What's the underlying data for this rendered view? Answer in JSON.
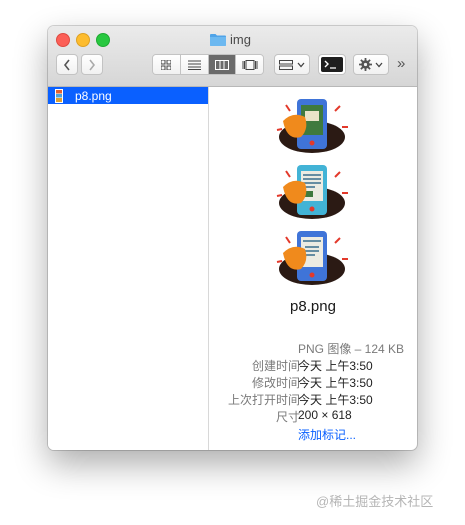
{
  "window": {
    "title": "img"
  },
  "toolbar": {
    "overflow_label": "»"
  },
  "sidebar": {
    "items": [
      {
        "label": "p8.png",
        "selected": true
      }
    ]
  },
  "preview": {
    "filename": "p8.png",
    "kind_size": "PNG 图像 – 124 KB",
    "info": [
      {
        "key": "创建时间",
        "value": "今天 上午3:50"
      },
      {
        "key": "修改时间",
        "value": "今天 上午3:50"
      },
      {
        "key": "上次打开时间",
        "value": "今天 上午3:50"
      },
      {
        "key": "尺寸",
        "value": "200 × 618"
      }
    ],
    "add_tags": "添加标记..."
  },
  "watermark": "@稀土掘金技术社区",
  "colors": {
    "selection": "#0a60ff",
    "link": "#0a60ff",
    "traffic_red": "#fc5f57",
    "traffic_yellow": "#fdbc2e",
    "traffic_green": "#28c840"
  }
}
